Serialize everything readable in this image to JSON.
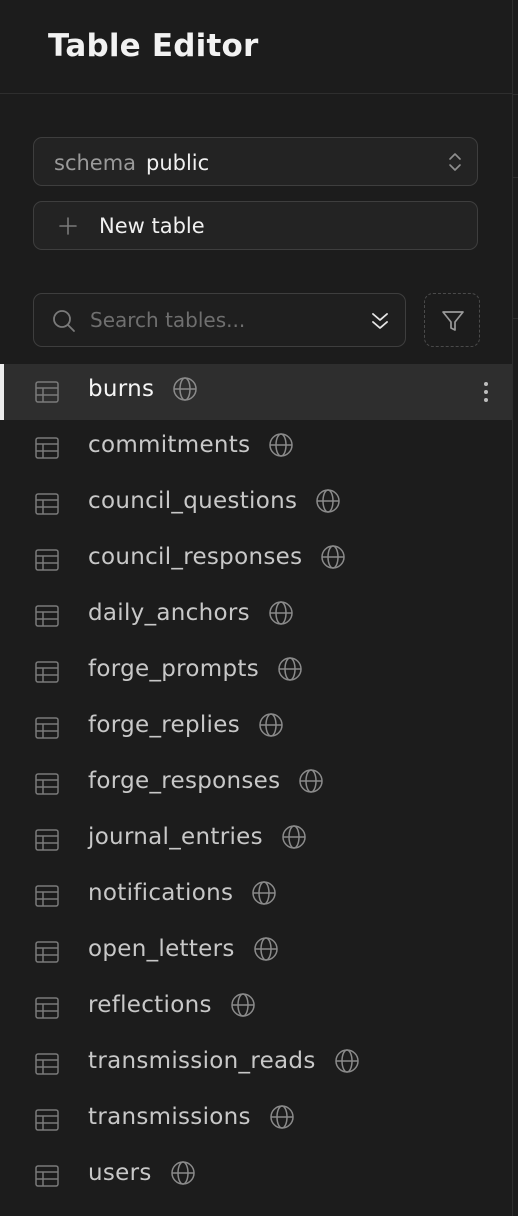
{
  "header": {
    "title": "Table Editor"
  },
  "schema": {
    "label": "schema",
    "value": "public"
  },
  "toolbar": {
    "new_table_label": "New table"
  },
  "search": {
    "placeholder": "Search tables..."
  },
  "icons": {
    "schema_chevron": "chevron-up-down-icon",
    "new_table": "plus-icon",
    "search": "search-icon",
    "sort": "chevrons-down-icon",
    "filter": "filter-icon",
    "table": "table-icon",
    "public": "globe-icon",
    "row_menu": "more-vertical-icon"
  },
  "tables": [
    {
      "name": "burns",
      "active": true
    },
    {
      "name": "commitments"
    },
    {
      "name": "council_questions"
    },
    {
      "name": "council_responses"
    },
    {
      "name": "daily_anchors"
    },
    {
      "name": "forge_prompts"
    },
    {
      "name": "forge_replies"
    },
    {
      "name": "forge_responses"
    },
    {
      "name": "journal_entries"
    },
    {
      "name": "notifications"
    },
    {
      "name": "open_letters"
    },
    {
      "name": "reflections"
    },
    {
      "name": "transmission_reads"
    },
    {
      "name": "transmissions"
    },
    {
      "name": "users"
    }
  ],
  "colors": {
    "background": "#1c1c1c",
    "border": "#3e3e3e",
    "active_row": "#2e2e2e",
    "text": "#ededed",
    "muted_text": "#9a9a9a"
  }
}
